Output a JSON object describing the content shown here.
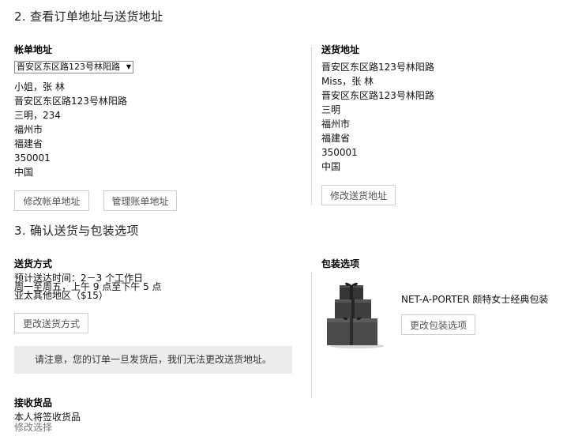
{
  "step2": {
    "title": "2. 查看订单地址与送货地址",
    "billing": {
      "heading": "帐单地址",
      "select_value": "晋安区东区路123号林阳路",
      "lines": [
        "小姐，张 林",
        "晋安区东区路123号林阳路",
        "三明，234",
        "福州市",
        "福建省",
        "350001",
        "中国"
      ],
      "edit_button": "修改帐单地址",
      "manage_button": "管理账单地址"
    },
    "shipping": {
      "heading": "送货地址",
      "lines": [
        "晋安区东区路123号林阳路",
        "Miss，张 林",
        "晋安区东区路123号林阳路",
        "三明",
        "福州市",
        "福建省",
        "350001",
        "中国"
      ],
      "edit_button": "修改送货地址"
    }
  },
  "step3": {
    "title": "3. 确认送货与包装选项",
    "delivery": {
      "heading": "送货方式",
      "lines": [
        "预计送达时间：2－3 个工作日",
        "周一至周五，上午 9 点至下午 5 点",
        "亚太其他地区（$15）"
      ],
      "change_button": "更改送货方式"
    },
    "packaging": {
      "heading": "包装选项",
      "product_name": "NET-A-PORTER 颇特女士经典包装",
      "change_button": "更改包装选项"
    },
    "notice": "请注意，您的订单一旦发货后，我们无法更改送货地址。",
    "receipt": {
      "heading": "接收货品",
      "value": "本人将签收货品",
      "change_link": "修改选择"
    }
  },
  "icons": {
    "dropdown": "triangle-down-icon",
    "gift_box": "gift-box-icon"
  }
}
